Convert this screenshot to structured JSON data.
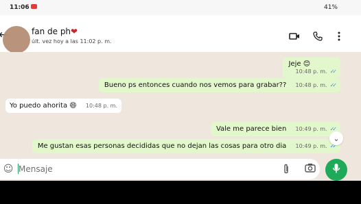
{
  "status": {
    "time": "11:06",
    "battery": "41%"
  },
  "contact": {
    "name": "fan de  ph",
    "heart": "❤",
    "last_seen": "últ. vez hoy a las 11:02 p. m."
  },
  "messages": [
    {
      "dir": "out",
      "text": "Jeje",
      "emoji": "😊",
      "time": "10:48 p. m."
    },
    {
      "dir": "out",
      "text": "Bueno ps entonces cuando nos vemos para grabar??",
      "time": "10:48 p. m."
    },
    {
      "dir": "in",
      "text": "Yo puedo ahorita",
      "emoji": "😄",
      "time": "10:48 p. m."
    },
    {
      "dir": "out",
      "text": "Vale me parece bien",
      "time": "10:49 p. m."
    },
    {
      "dir": "out",
      "text": "Me gustan esas personas decididas que no dejan las cosas para otro dia",
      "time": "10:49 p. m."
    }
  ],
  "composer": {
    "placeholder": "Mensaje"
  },
  "icons": {
    "back": "back-arrow-icon",
    "video": "video-call-icon",
    "call": "phone-icon",
    "more": "more-vert-icon",
    "emoji": "emoji-icon",
    "attach": "attach-icon",
    "camera": "camera-icon",
    "mic": "mic-icon"
  },
  "colors": {
    "accent": "#1faa59",
    "outgoing_bubble": "#e2f7cb",
    "chat_bg": "#efe7de",
    "read_ticks": "#3b8fd6"
  }
}
